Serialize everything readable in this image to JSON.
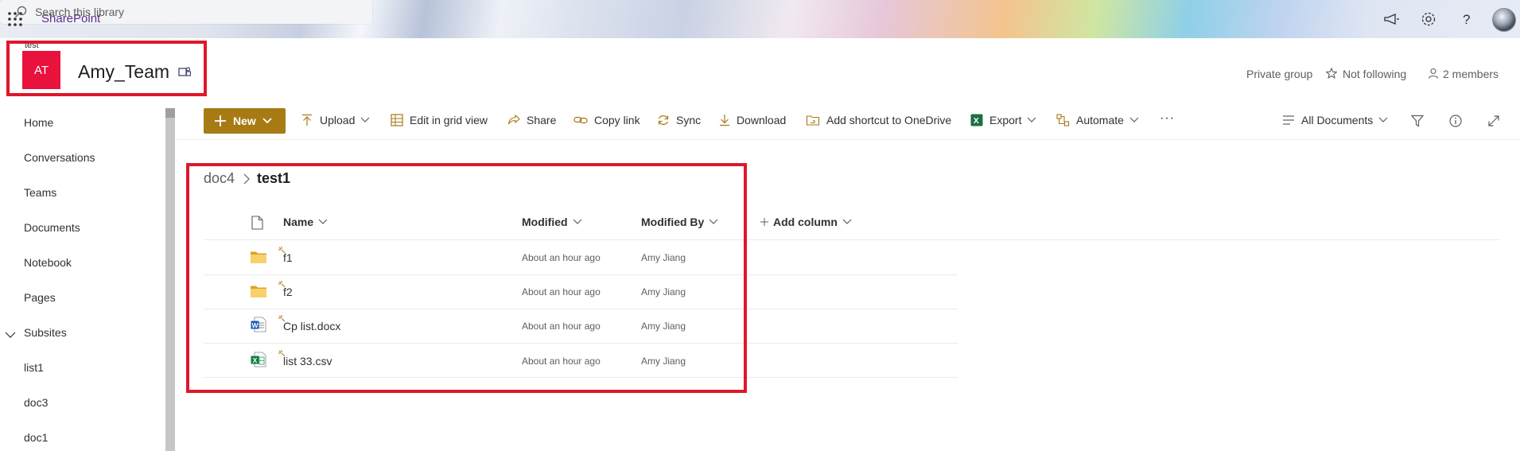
{
  "suite": {
    "app_name": "SharePoint",
    "search_placeholder": "Search this library"
  },
  "site": {
    "breadcrumb": "test",
    "logo_initials": "AT",
    "logo_color": "#e8123c",
    "title": "Amy_Team",
    "privacy": "Private group",
    "follow": "Not following",
    "members": "2 members"
  },
  "nav": {
    "items": [
      "Home",
      "Conversations",
      "Teams",
      "Documents",
      "Notebook",
      "Pages",
      "Subsites",
      "list1",
      "doc3",
      "doc1"
    ]
  },
  "commands": {
    "new": "New",
    "upload": "Upload",
    "grid": "Edit in grid view",
    "share": "Share",
    "copy_link": "Copy link",
    "sync": "Sync",
    "download": "Download",
    "shortcut": "Add shortcut to OneDrive",
    "export": "Export",
    "automate": "Automate",
    "more": "···",
    "view": "All Documents"
  },
  "library": {
    "breadcrumb_root": "doc4",
    "breadcrumb_current": "test1",
    "columns": {
      "name": "Name",
      "modified": "Modified",
      "modified_by": "Modified By",
      "add_column": "Add column"
    },
    "rows": [
      {
        "type": "folder",
        "name": "f1",
        "modified": "About an hour ago",
        "modified_by": "Amy Jiang"
      },
      {
        "type": "folder",
        "name": "f2",
        "modified": "About an hour ago",
        "modified_by": "Amy Jiang"
      },
      {
        "type": "word",
        "name": "Cp list.docx",
        "modified": "About an hour ago",
        "modified_by": "Amy Jiang"
      },
      {
        "type": "excel",
        "name": "list 33.csv",
        "modified": "About an hour ago",
        "modified_by": "Amy Jiang"
      }
    ]
  },
  "colors": {
    "accent": "#a77a14",
    "brand": "#5b2d91",
    "highlight": "#e0162b"
  }
}
